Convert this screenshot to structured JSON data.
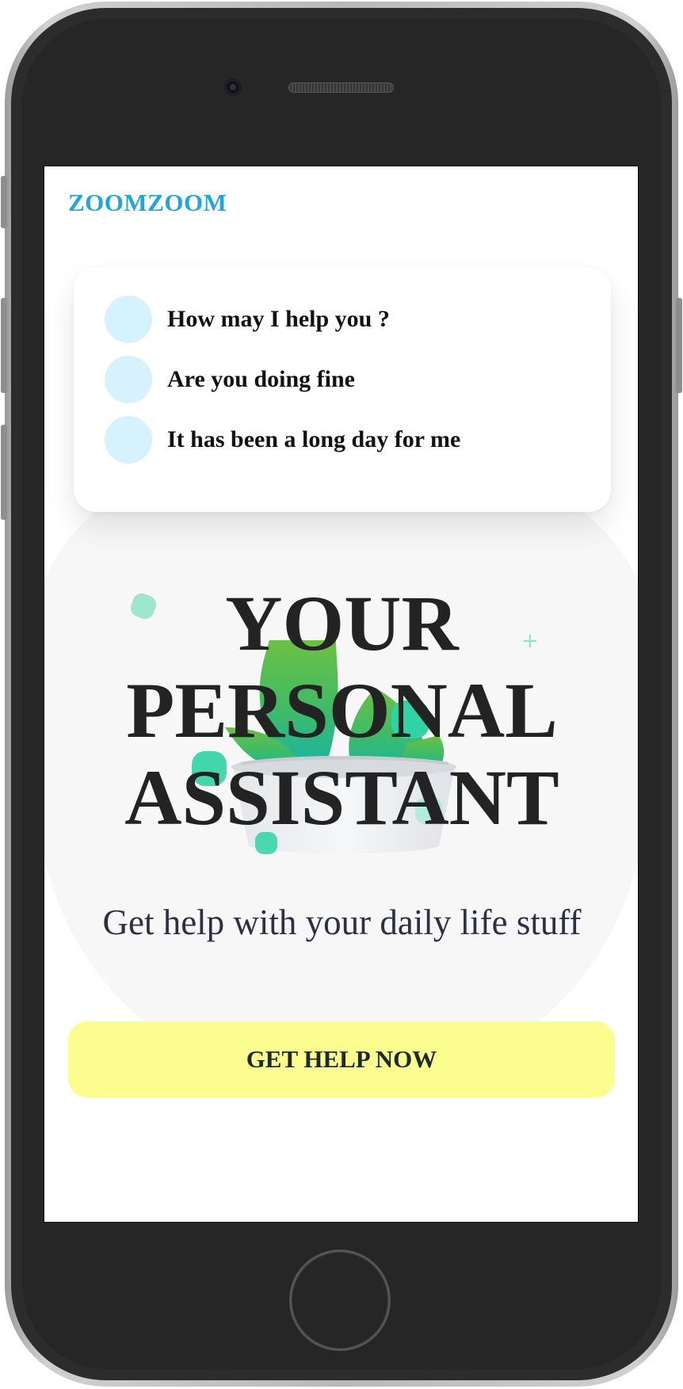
{
  "app": {
    "brand": "ZOOMZOOM"
  },
  "chat": {
    "messages": [
      "How may I help you ?",
      "Are you doing fine",
      "It has been a long day for me"
    ]
  },
  "hero": {
    "headline_line1": "YOUR",
    "headline_line2": "PERSONAL",
    "headline_line3": "ASSISTANT",
    "subtitle": "Get help with your daily life stuff"
  },
  "cta": {
    "label": "GET HELP NOW"
  },
  "colors": {
    "brand": "#1ea7d9",
    "avatar": "#d6f2fc",
    "cta_background": "#fcfd8f",
    "headline": "#232323",
    "leaf_green": "#4ec05c",
    "accent_teal": "#2fd3a5"
  },
  "icons": {
    "illustration": "plant-pot-illustration",
    "camera": "front-camera-icon",
    "home": "home-button-icon"
  }
}
